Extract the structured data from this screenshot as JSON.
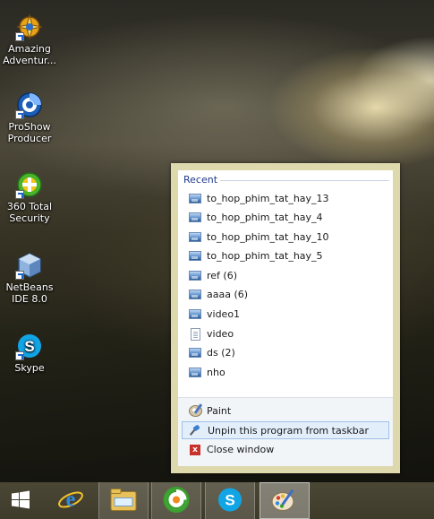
{
  "desktop": {
    "icons": [
      {
        "label": "Amazing Adventur...",
        "icon": "amazing-adventures-icon"
      },
      {
        "label": "ProShow Producer",
        "icon": "proshow-producer-icon"
      },
      {
        "label": "360 Total Security",
        "icon": "360-total-security-icon"
      },
      {
        "label": "NetBeans IDE 8.0",
        "icon": "netbeans-ide-icon"
      },
      {
        "label": "Skype",
        "icon": "skype-icon"
      }
    ]
  },
  "jumplist": {
    "recent_header": "Recent",
    "recent": [
      {
        "label": "to_hop_phim_tat_hay_13",
        "icon": "image-file-icon"
      },
      {
        "label": "to_hop_phim_tat_hay_4",
        "icon": "image-file-icon"
      },
      {
        "label": "to_hop_phim_tat_hay_10",
        "icon": "image-file-icon"
      },
      {
        "label": "to_hop_phim_tat_hay_5",
        "icon": "image-file-icon"
      },
      {
        "label": "ref (6)",
        "icon": "image-file-icon"
      },
      {
        "label": "aaaa (6)",
        "icon": "image-file-icon"
      },
      {
        "label": "video1",
        "icon": "image-file-icon"
      },
      {
        "label": "video",
        "icon": "document-file-icon"
      },
      {
        "label": "ds (2)",
        "icon": "image-file-icon"
      },
      {
        "label": "nho",
        "icon": "image-file-icon"
      }
    ],
    "tasks": [
      {
        "label": "Paint",
        "icon": "paint-icon"
      },
      {
        "label": "Unpin this program from taskbar",
        "icon": "unpin-icon"
      },
      {
        "label": "Close window",
        "icon": "close-window-icon"
      }
    ]
  },
  "taskbar": {
    "buttons": [
      {
        "name": "start",
        "icon": "windows-start-icon"
      },
      {
        "name": "internet-explorer",
        "icon": "internet-explorer-icon"
      },
      {
        "name": "file-explorer",
        "icon": "file-explorer-icon"
      },
      {
        "name": "greenshot",
        "icon": "greenshot-icon"
      },
      {
        "name": "skype",
        "icon": "skype-icon"
      },
      {
        "name": "paint",
        "icon": "paint-icon"
      }
    ]
  },
  "colors": {
    "jumplist_frame": "#ded8ad",
    "jumplist_header": "#1e3a8a",
    "taskbar": "#4b4735",
    "hover_item": "#e3eefb"
  }
}
